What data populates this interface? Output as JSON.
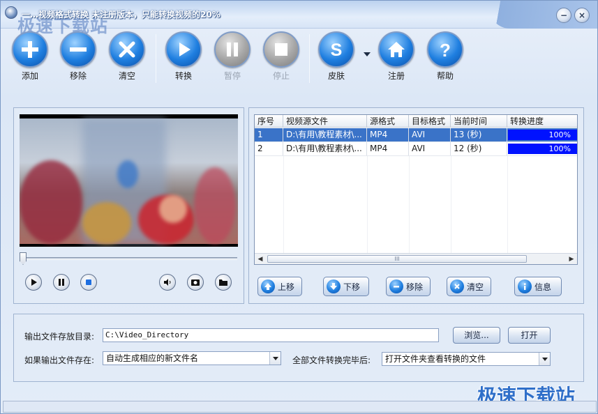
{
  "titlebar": {
    "title": "一…视频格式转换 未注册版本，只能转换视频的20%",
    "watermark": "极速下载站",
    "minimize": "−",
    "close": "×"
  },
  "toolbar": {
    "add": "添加",
    "remove": "移除",
    "clear": "清空",
    "convert": "转换",
    "pause": "暂停",
    "stop": "停止",
    "skin": "皮肤",
    "register": "注册",
    "help": "帮助"
  },
  "file_list": {
    "columns": [
      "序号",
      "视频源文件",
      "源格式",
      "目标格式",
      "当前时间",
      "转换进度"
    ],
    "rows": [
      {
        "index": "1",
        "source": "D:\\有用\\教程素材\\...",
        "src_format": "MP4",
        "dst_format": "AVI",
        "time": "13 (秒)",
        "progress": "100%",
        "progress_value": 1.0,
        "selected": true
      },
      {
        "index": "2",
        "source": "D:\\有用\\教程素材\\...",
        "src_format": "MP4",
        "dst_format": "AVI",
        "time": "12 (秒)",
        "progress": "100%",
        "progress_value": 1.0,
        "selected": false
      }
    ],
    "scroll_thumb": "III"
  },
  "list_actions": {
    "up": "上移",
    "down": "下移",
    "remove": "移除",
    "clear": "清空",
    "info": "信息"
  },
  "output": {
    "dir_label": "输出文件存放目录:",
    "dir_value": "C:\\Video_Directory",
    "browse": "浏览...",
    "open": "打开",
    "exists_label": "如果输出文件存在:",
    "exists_value": "自动生成相应的新文件名",
    "after_label": "全部文件转换完毕后:",
    "after_value": "打开文件夹查看转换的文件"
  },
  "player": {
    "seek_fraction": 0.0
  },
  "colors": {
    "accent_blue": "#1f7fe0",
    "selection": "#3a73c8",
    "progress": "#0012ff"
  },
  "watermark_bottom": "极速下载站"
}
